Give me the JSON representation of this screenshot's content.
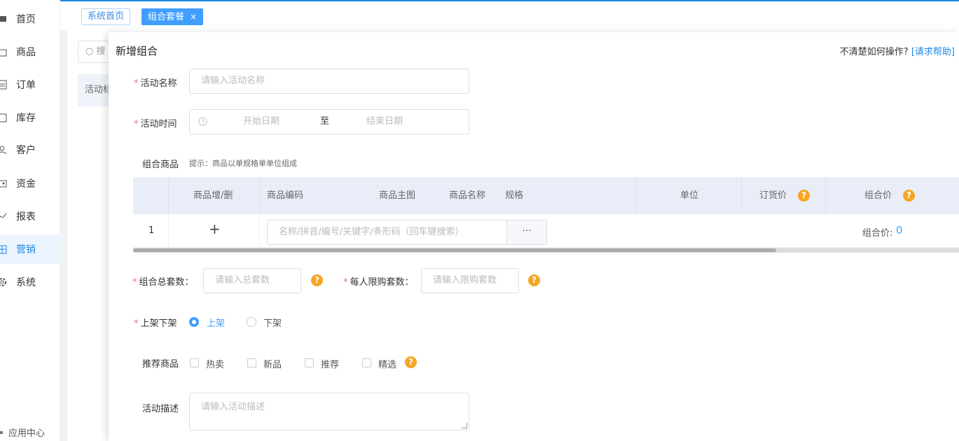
{
  "sidebar": {
    "items": [
      {
        "label": "首页",
        "icon": "home-icon"
      },
      {
        "label": "商品",
        "icon": "bag-icon"
      },
      {
        "label": "订单",
        "icon": "order-icon"
      },
      {
        "label": "库存",
        "icon": "warehouse-icon"
      },
      {
        "label": "客户",
        "icon": "user-icon"
      },
      {
        "label": "资金",
        "icon": "wallet-icon"
      },
      {
        "label": "报表",
        "icon": "chart-icon"
      },
      {
        "label": "营销",
        "icon": "marketing-icon",
        "active": true
      },
      {
        "label": "系统",
        "icon": "gear-icon"
      }
    ],
    "app_center": "应用中心"
  },
  "tabs": {
    "home": "系统首页",
    "current": "组合套餐",
    "close": "×"
  },
  "background": {
    "search_placeholder": "搜",
    "strip_text": "活动标"
  },
  "drawer": {
    "title": "新增组合",
    "help_text": "不清楚如何操作?",
    "help_link": "[请求帮助]"
  },
  "form": {
    "name_label": "活动名称",
    "name_placeholder": "请输入活动名称",
    "time_label": "活动时间",
    "start_placeholder": "开始日期",
    "to": "至",
    "end_placeholder": "结束日期",
    "goods_label": "组合商品",
    "goods_hint": "提示：商品以单规格单单位组成",
    "total_label": "组合总套数：",
    "total_placeholder": "请输入总套数",
    "limit_label": "每人限购套数：",
    "limit_placeholder": "请输入限购套数",
    "shelf_label": "上架下架",
    "shelf_on": "上架",
    "shelf_off": "下架",
    "recommend_label": "推荐商品",
    "recommend_options": [
      "热卖",
      "新品",
      "推荐",
      "精选"
    ],
    "desc_label": "活动描述",
    "desc_placeholder": "请输入活动描述",
    "required_mark": "*",
    "question_mark": "?"
  },
  "table": {
    "headers": [
      "商品增/删",
      "商品编码",
      "商品主图",
      "商品名称",
      "规格",
      "单位",
      "订货价",
      "组合价"
    ],
    "row_index": "1",
    "add_symbol": "+",
    "search_placeholder": "名称/拼音/编号/关键字/条形码（回车键搜索）",
    "more_symbol": "···",
    "combo_price_label": "组合价:",
    "combo_price_value": "0"
  },
  "colors": {
    "accent": "#409eff",
    "help_icon": "#f5a623",
    "required": "#f56c6c"
  }
}
